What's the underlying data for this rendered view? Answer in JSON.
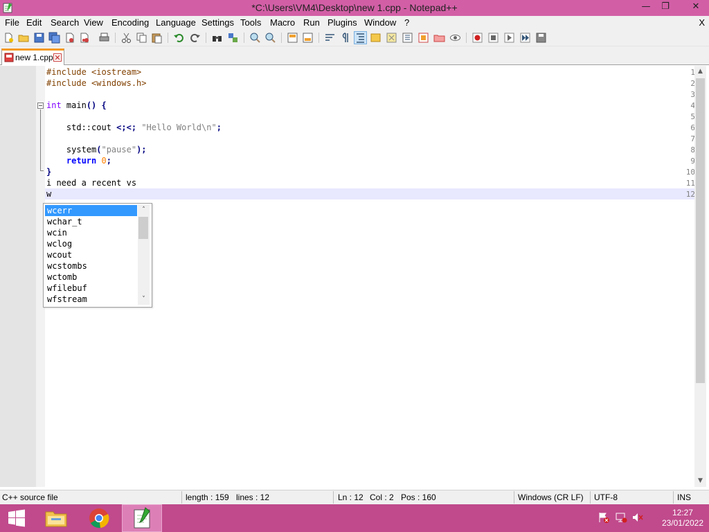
{
  "window": {
    "title": "*C:\\Users\\VM4\\Desktop\\new 1.cpp - Notepad++",
    "minimize": "—",
    "restore": "❐",
    "close": "✕"
  },
  "menu": {
    "items": [
      "File",
      "Edit",
      "Search",
      "View",
      "Encoding",
      "Language",
      "Settings",
      "Tools",
      "Macro",
      "Run",
      "Plugins",
      "Window",
      "?"
    ],
    "close": "X"
  },
  "tab": {
    "label": "new 1.cpp"
  },
  "editor": {
    "line_numbers": [
      "1",
      "2",
      "3",
      "4",
      "5",
      "6",
      "7",
      "8",
      "9",
      "10",
      "11",
      "12"
    ],
    "lines": [
      "#include <iostream>",
      "#include <windows.h>",
      "",
      "int main() {",
      "",
      "    std::cout << \"Hello World\\n\";",
      "",
      "    system(\"pause\");",
      "    return 0;",
      "}",
      "i need a recent vs",
      "w"
    ]
  },
  "autocomplete": {
    "items": [
      "wcerr",
      "wchar_t",
      "wcin",
      "wclog",
      "wcout",
      "wcstombs",
      "wctomb",
      "wfilebuf",
      "wfstream"
    ],
    "selected_index": 0
  },
  "status": {
    "language": "C++ source file",
    "length": "length : 159",
    "lines": "lines : 12",
    "ln": "Ln : 12",
    "col": "Col : 2",
    "pos": "Pos : 160",
    "eol": "Windows (CR LF)",
    "encoding": "UTF-8",
    "mode": "INS"
  },
  "taskbar": {
    "time": "12:27",
    "date": "23/01/2022"
  },
  "colors": {
    "titlebar": "#d25fa6",
    "taskbar": "#c04a8c",
    "tab_accent": "#f59a23",
    "selection": "#3399ff",
    "keyword": "#0000ff",
    "type": "#8000ff",
    "preprocessor": "#804000",
    "string": "#808080",
    "number": "#ff8000"
  }
}
